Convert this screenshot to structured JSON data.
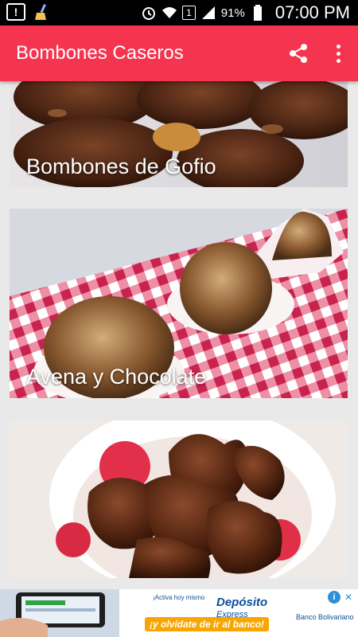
{
  "status_bar": {
    "battery": "91%",
    "sim": "1",
    "time": "07:00 PM",
    "icons": [
      "alert-icon",
      "broom-icon",
      "alarm-icon",
      "wifi-icon",
      "signal-icon",
      "battery-icon"
    ]
  },
  "app_bar": {
    "title": "Bombones Caseros",
    "actions": [
      "share-icon",
      "more-vert-icon"
    ],
    "color": "#f5354f"
  },
  "recipes": [
    {
      "label": "Bombones de Gofio"
    },
    {
      "label": "Avena y Chocolate"
    },
    {
      "label": ""
    }
  ],
  "ad": {
    "small_text": "¡Activa hoy mismo",
    "title": "Depósito",
    "subtitle": "Express",
    "tagline": "¡y olvídate de ir al banco!",
    "bank": "Banco Bolivariano",
    "adchoices": "i",
    "close": "✕"
  }
}
